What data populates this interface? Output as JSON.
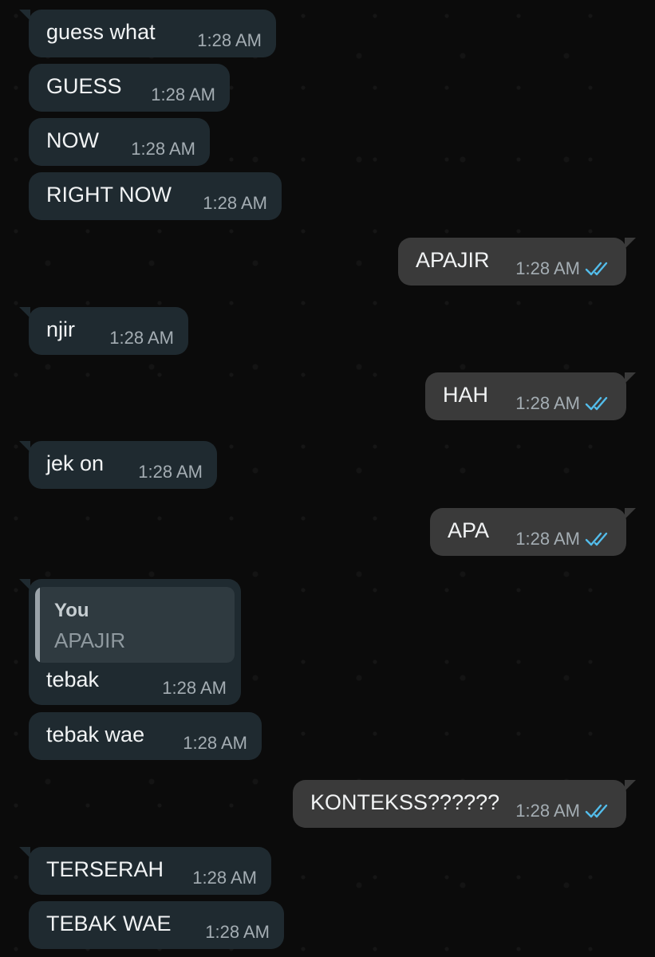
{
  "chat": {
    "quoted_reply": {
      "author": "You",
      "text": "APAJIR"
    },
    "messages": [
      {
        "text": "guess what",
        "time": "1:28 AM"
      },
      {
        "text": "GUESS",
        "time": "1:28 AM"
      },
      {
        "text": "NOW",
        "time": "1:28 AM"
      },
      {
        "text": "RIGHT NOW",
        "time": "1:28 AM"
      },
      {
        "text": "APAJIR",
        "time": "1:28 AM",
        "status": "read"
      },
      {
        "text": "njir",
        "time": "1:28 AM"
      },
      {
        "text": "HAH",
        "time": "1:28 AM",
        "status": "read"
      },
      {
        "text": "jek on",
        "time": "1:28 AM"
      },
      {
        "text": "APA",
        "time": "1:28 AM",
        "status": "read"
      },
      {
        "text": "tebak",
        "time": "1:28 AM"
      },
      {
        "text": "tebak wae",
        "time": "1:28 AM"
      },
      {
        "text": "KONTEKSS??????",
        "time": "1:28 AM",
        "status": "read"
      },
      {
        "text": "TERSERAH",
        "time": "1:28 AM"
      },
      {
        "text": "TEBAK WAE",
        "time": "1:28 AM"
      }
    ]
  },
  "colors": {
    "incoming_bubble": "#1f2a30",
    "outgoing_bubble": "#3a3a3a",
    "read_ticks": "#53bdeb",
    "background": "#0b0b0b"
  }
}
